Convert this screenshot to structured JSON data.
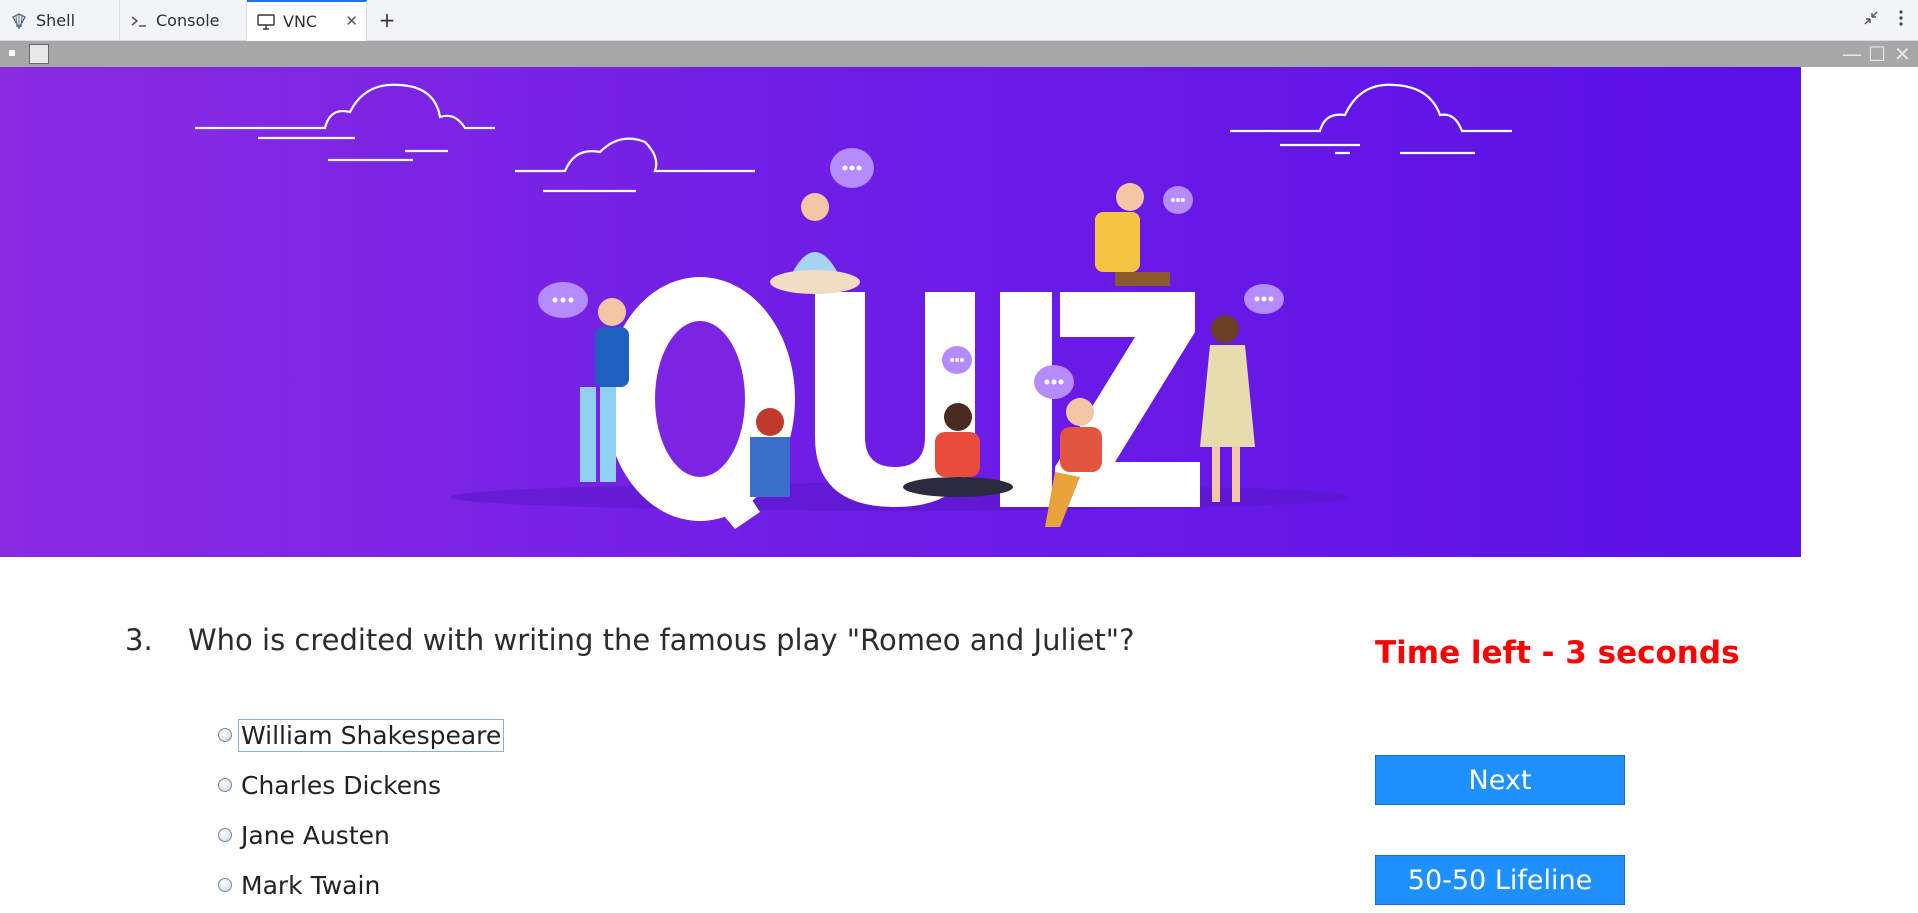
{
  "tabs": [
    {
      "label": "Shell",
      "icon": "shell-icon"
    },
    {
      "label": "Console",
      "icon": "terminal-icon"
    },
    {
      "label": "VNC",
      "icon": "monitor-icon",
      "active": true
    }
  ],
  "banner": {
    "word": "QUIZ"
  },
  "quiz": {
    "question_number": "3.",
    "question_text": "Who is credited with writing the famous play \"Romeo and Juliet\"?",
    "timer_text": "Time left - 3 seconds",
    "options": [
      {
        "label": "William Shakespeare",
        "focused": true
      },
      {
        "label": "Charles Dickens"
      },
      {
        "label": "Jane Austen"
      },
      {
        "label": "Mark Twain"
      }
    ],
    "next_label": "Next",
    "lifeline_label": "50-50 Lifeline"
  },
  "colors": {
    "banner_start": "#8a2be2",
    "banner_end": "#5a10e6",
    "timer": "#ff0000",
    "button": "#1e90ff"
  }
}
